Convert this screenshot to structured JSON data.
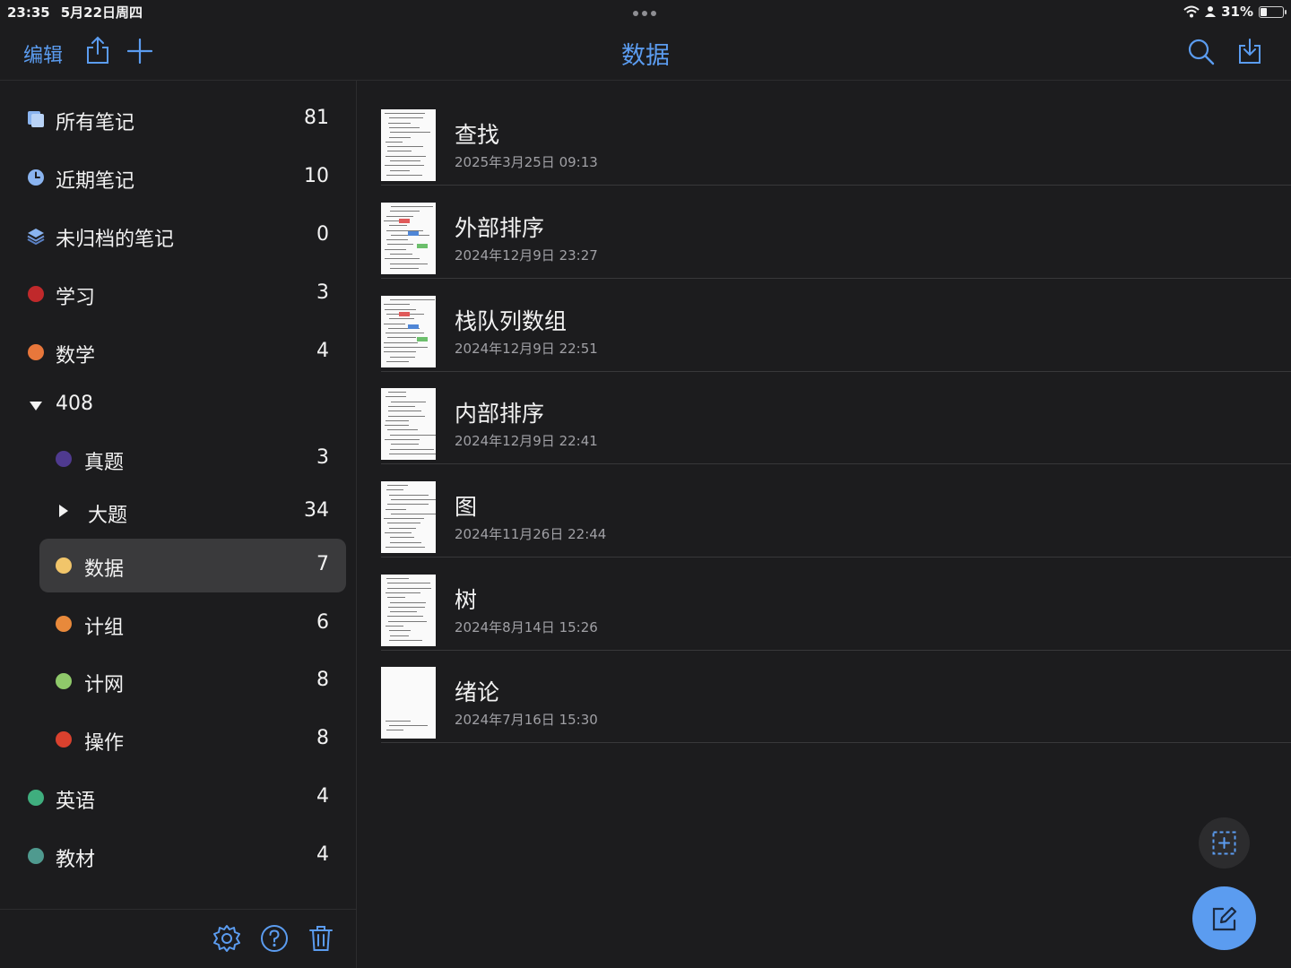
{
  "status": {
    "time": "23:35",
    "date": "5月22日周四",
    "battery": "31%",
    "battery_level": 0.31
  },
  "nav": {
    "edit_label": "编辑",
    "title": "数据"
  },
  "sidebar": {
    "items": [
      {
        "label": "所有笔记",
        "count": "81"
      },
      {
        "label": "近期笔记",
        "count": "10"
      },
      {
        "label": "未归档的笔记",
        "count": "0"
      },
      {
        "label": "学习",
        "count": "3",
        "color": "#c0292b"
      },
      {
        "label": "数学",
        "count": "4",
        "color": "#e8773b"
      },
      {
        "label": "408",
        "count": ""
      },
      {
        "label": "真题",
        "count": "3",
        "color": "#4f3a8f"
      },
      {
        "label": "大题",
        "count": "34"
      },
      {
        "label": "数据",
        "count": "7",
        "color": "#f1c56a",
        "selected": true
      },
      {
        "label": "计组",
        "count": "6",
        "color": "#e8893b"
      },
      {
        "label": "计网",
        "count": "8",
        "color": "#8fc96a"
      },
      {
        "label": "操作",
        "count": "8",
        "color": "#d9412e"
      },
      {
        "label": "英语",
        "count": "4",
        "color": "#3fae7e"
      },
      {
        "label": "教材",
        "count": "4",
        "color": "#4f9a8f"
      }
    ]
  },
  "notes": [
    {
      "title": "查找",
      "date": "2025年3月25日 09:13"
    },
    {
      "title": "外部排序",
      "date": "2024年12月9日 23:27"
    },
    {
      "title": "栈队列数组",
      "date": "2024年12月9日 22:51"
    },
    {
      "title": "内部排序",
      "date": "2024年12月9日 22:41"
    },
    {
      "title": "图",
      "date": "2024年11月26日 22:44"
    },
    {
      "title": "树",
      "date": "2024年8月14日 15:26"
    },
    {
      "title": "绪论",
      "date": "2024年7月16日 15:30"
    }
  ],
  "colors": {
    "accent": "#5b9cf0",
    "background": "#1c1c1e",
    "selected_row": "#3a3a3c"
  }
}
